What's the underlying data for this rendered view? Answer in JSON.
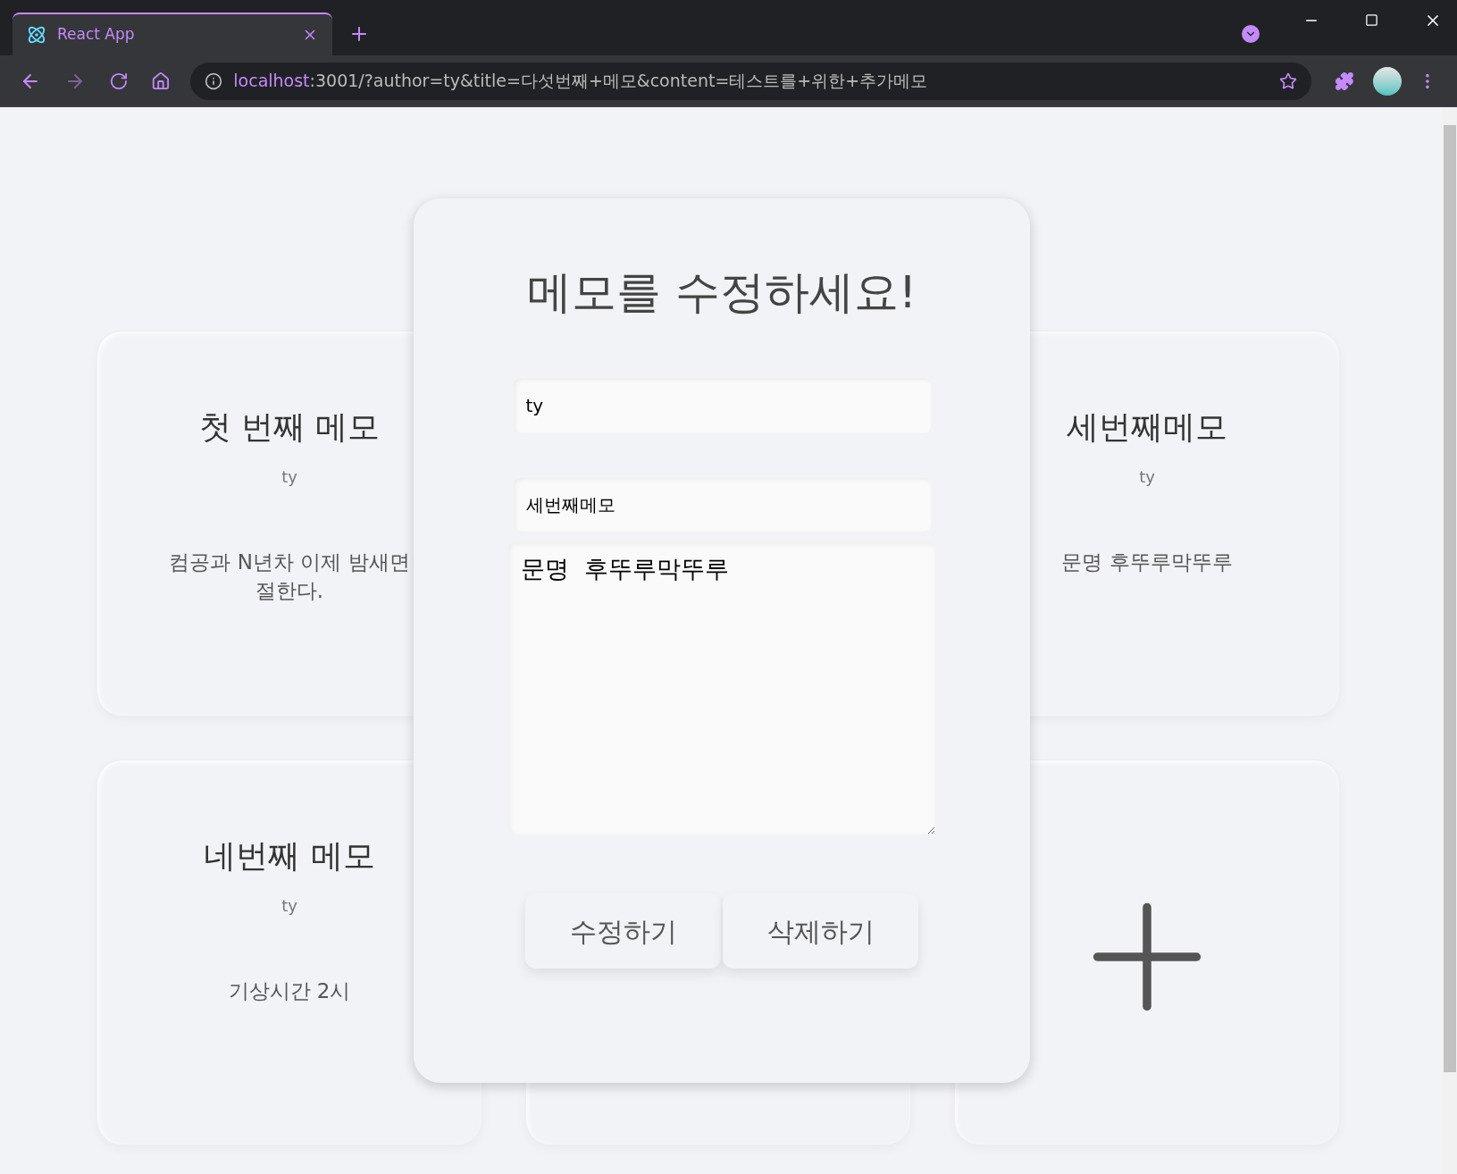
{
  "browser": {
    "tab": {
      "title": "React App",
      "selected": true
    },
    "url": {
      "host": "localhost",
      "rest": ":3001/?author=ty&title=다섯번째+메모&content=테스트를+위한+추가메모"
    }
  },
  "cards": [
    {
      "kind": "memo",
      "title": "첫 번째 메모",
      "author": "ty",
      "content": [
        "컴공과 N년차 이제 밤새면",
        "절한다."
      ]
    },
    {
      "kind": "covered"
    },
    {
      "kind": "memo",
      "title": "세번째메모",
      "author": "ty",
      "content": [
        "문명 후뚜루막뚜루"
      ]
    },
    {
      "kind": "memo",
      "title": "네번째 메모",
      "author": "ty",
      "content": [
        "기상시간 2시"
      ]
    },
    {
      "kind": "empty"
    },
    {
      "kind": "add"
    }
  ],
  "modal": {
    "title": "메모를 수정하세요!",
    "author_field": "ty",
    "title_field": "세번째메모",
    "content_field": "문명  후뚜루막뚜루",
    "buttons": [
      "수정하기",
      "삭제하기"
    ]
  }
}
